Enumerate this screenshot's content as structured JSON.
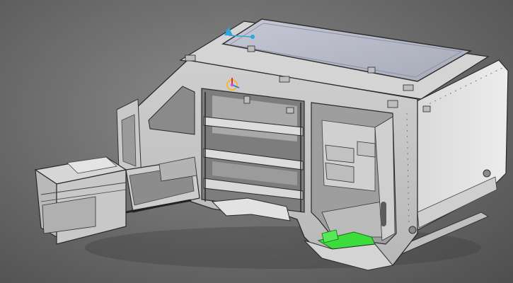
{
  "viewport": {
    "background_top": "#8d8d8d",
    "background_bottom": "#4e4e4e"
  },
  "model": {
    "body_color": "#d8d8d8",
    "edge_color": "#2a2a2a",
    "highlight_color": "#3ddc3d",
    "roof_panel_color": "#b9bccb",
    "dark_interior_color": "#6f6f6f"
  },
  "gizmos": {
    "transform_icon": "transform-gizmo-icon",
    "pivot_icon": "pivot-gizmo-icon"
  }
}
